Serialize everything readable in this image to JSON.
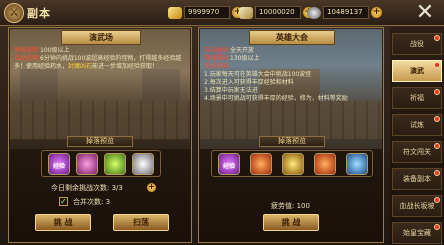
{
  "header": {
    "title": "副本",
    "currencies": [
      {
        "icon": "gold-ingot-icon",
        "value": "9999970"
      },
      {
        "icon": "silver-ingot-icon",
        "value": "10000020"
      },
      {
        "icon": "orb-icon",
        "value": "10489137"
      }
    ]
  },
  "left": {
    "title": "演武场",
    "level_label": "等级限制:",
    "level_value": "100级以上",
    "desc_label": "活动说明:",
    "desc_text": "6分钟内挑战100波超高经验的怪物，打得越多经验越多！使用经验药水，",
    "desc_hl": "封魔凶石",
    "desc_tail": "能进一步增加经验获取！",
    "drop_label": "掉落预览",
    "items": [
      {
        "text": "经验",
        "icon": "exp-orb-icon"
      },
      {
        "text": "",
        "icon": "pink-gem-icon"
      },
      {
        "text": "",
        "icon": "green-gem-icon"
      },
      {
        "text": "",
        "icon": "silver-coin-icon"
      }
    ],
    "remaining_label": "今日剩余挑战次数:",
    "remaining_value": "3/3",
    "merge_label": "合并次数:",
    "merge_value": "3",
    "challenge_btn": "挑 战",
    "sweep_btn": "扫荡"
  },
  "right": {
    "title": "英雄大会",
    "open_label": "开启时间:",
    "open_value": "全天开放",
    "level_label": "等级限制:",
    "level_value": "130级以上",
    "desc_label": "活动说明:",
    "desc_lines": [
      "1.玩家每天可在英雄大会中挑战100波怪",
      "2.每次进入可获得丰厚经验和材料",
      "3.结算中玩家无法进",
      "4.场景中可挑战可获得丰厚的经验，修为，材料等奖励"
    ],
    "drop_label": "掉落预览",
    "items": [
      {
        "text": "经验",
        "icon": "exp-orb-icon"
      },
      {
        "text": "",
        "icon": "red-gem-icon"
      },
      {
        "text": "",
        "icon": "gold-gem-icon"
      },
      {
        "text": "",
        "icon": "red-flame-icon"
      },
      {
        "text": "",
        "icon": "blue-flame-icon"
      }
    ],
    "stamina_label": "疲劳值:",
    "stamina_value": "100",
    "challenge_btn": "挑 战"
  },
  "side_menu": [
    {
      "label": "战役",
      "active": false,
      "badge": true
    },
    {
      "label": "演武",
      "active": true,
      "badge": true
    },
    {
      "label": "祈福",
      "active": false,
      "badge": true
    },
    {
      "label": "试炼",
      "active": false,
      "badge": true
    },
    {
      "label": "符文闯关",
      "active": false,
      "badge": true
    },
    {
      "label": "装备副本",
      "active": false,
      "badge": true
    },
    {
      "label": "血战长坂坡",
      "active": false,
      "badge": true
    },
    {
      "label": "始皇宝藏",
      "active": false,
      "badge": true
    }
  ]
}
